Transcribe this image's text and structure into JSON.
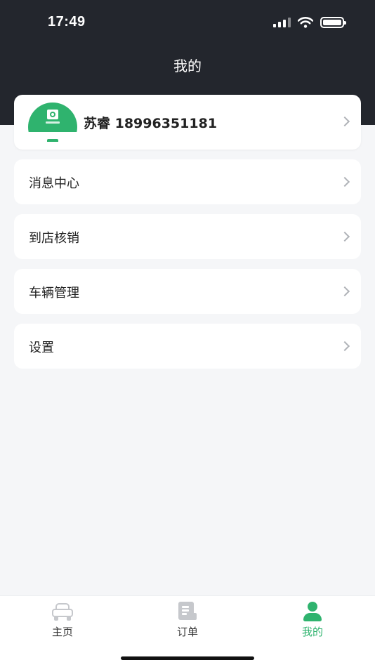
{
  "status_bar": {
    "time": "17:49"
  },
  "header": {
    "title": "我的"
  },
  "profile": {
    "name": "苏睿 18996351181"
  },
  "menu": [
    {
      "label": "消息中心"
    },
    {
      "label": "到店核销"
    },
    {
      "label": "车辆管理"
    },
    {
      "label": "设置"
    }
  ],
  "tabs": [
    {
      "label": "主页",
      "icon": "car-icon"
    },
    {
      "label": "订单",
      "icon": "order-icon"
    },
    {
      "label": "我的",
      "icon": "user-icon",
      "active": true
    }
  ],
  "colors": {
    "header": "#23262d",
    "accent": "#2fb36e",
    "background": "#f5f6f8"
  }
}
